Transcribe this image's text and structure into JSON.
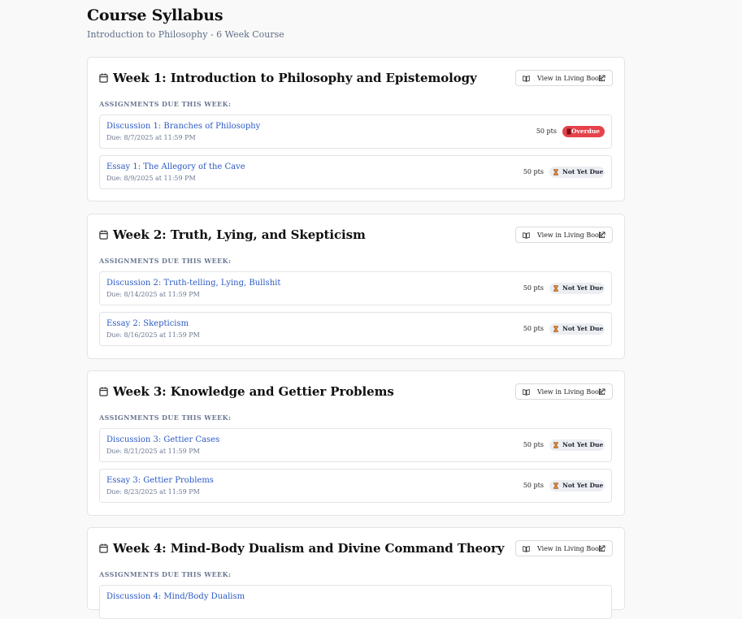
{
  "header": {
    "title": "Course Syllabus",
    "subtitle": "Introduction to Philosophy - 6 Week Course"
  },
  "colors": {
    "link": "#2b59c3",
    "overdue": "#e5424b",
    "pending_badge_bg": "#eceef2",
    "muted": "#6b7891"
  },
  "icons": {
    "week": "calendar-icon",
    "living_book": "book-open-icon",
    "external": "external-link-icon",
    "overdue": "alert-square-icon",
    "pending": "hourglass-icon"
  },
  "weeks": [
    {
      "title": "Week 1: Introduction to Philosophy and Epistemology",
      "button_label": "View in Living Book",
      "assignments_heading": "ASSIGNMENTS DUE THIS WEEK:",
      "assignments": [
        {
          "title": "Discussion 1: Branches of Philosophy",
          "due": "Due: 8/7/2025 at 11:59 PM",
          "points": "50 pts",
          "status": "Overdue"
        },
        {
          "title": "Essay 1: The Allegory of the Cave",
          "due": "Due: 8/9/2025 at 11:59 PM",
          "points": "50 pts",
          "status": "Not Yet Due"
        }
      ]
    },
    {
      "title": "Week 2: Truth, Lying, and Skepticism",
      "button_label": "View in Living Book",
      "assignments_heading": "ASSIGNMENTS DUE THIS WEEK:",
      "assignments": [
        {
          "title": "Discussion 2: Truth-telling, Lying, Bullshit",
          "due": "Due: 8/14/2025 at 11:59 PM",
          "points": "50 pts",
          "status": "Not Yet Due"
        },
        {
          "title": "Essay 2: Skepticism",
          "due": "Due: 8/16/2025 at 11:59 PM",
          "points": "50 pts",
          "status": "Not Yet Due"
        }
      ]
    },
    {
      "title": "Week 3: Knowledge and Gettier Problems",
      "button_label": "View in Living Book",
      "assignments_heading": "ASSIGNMENTS DUE THIS WEEK:",
      "assignments": [
        {
          "title": "Discussion 3: Gettier Cases",
          "due": "Due: 8/21/2025 at 11:59 PM",
          "points": "50 pts",
          "status": "Not Yet Due"
        },
        {
          "title": "Essay 3: Gettier Problems",
          "due": "Due: 8/23/2025 at 11:59 PM",
          "points": "50 pts",
          "status": "Not Yet Due"
        }
      ]
    },
    {
      "title": "Week 4: Mind-Body Dualism and Divine Command Theory",
      "button_label": "View in Living Book",
      "assignments_heading": "ASSIGNMENTS DUE THIS WEEK:",
      "assignments": [
        {
          "title": "Discussion 4: Mind/Body Dualism"
        }
      ]
    }
  ]
}
